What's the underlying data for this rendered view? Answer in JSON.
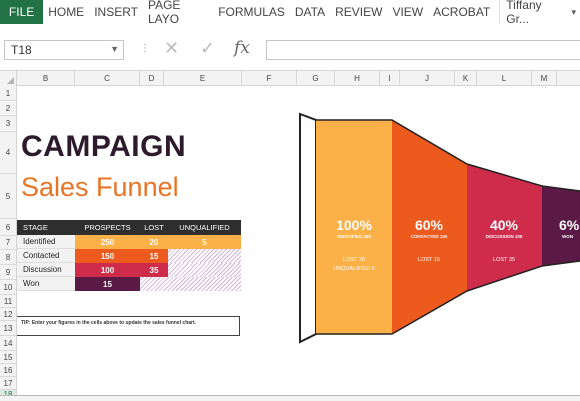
{
  "ribbon": {
    "file_tab": "FILE",
    "tabs": [
      "HOME",
      "INSERT",
      "PAGE LAYO",
      "FORMULAS",
      "DATA",
      "REVIEW",
      "VIEW",
      "ACROBAT"
    ],
    "user": "Tiffany Gr...",
    "user_dropdown": "▾"
  },
  "formula_bar": {
    "name_box": "T18",
    "fx": "fx",
    "value": ""
  },
  "columns": [
    "B",
    "C",
    "D",
    "E",
    "F",
    "G",
    "H",
    "I",
    "J",
    "K",
    "L",
    "M"
  ],
  "rows": [
    "1",
    "2",
    "3",
    "4",
    "5",
    "6",
    "7",
    "8",
    "9",
    "10",
    "11",
    "12",
    "13",
    "14",
    "15",
    "16",
    "17",
    "18"
  ],
  "sheet": {
    "title_line1": "CAMPAIGN",
    "title_line2": "Sales Funnel",
    "table": {
      "headers": [
        "STAGE",
        "PROSPECTS",
        "LOST",
        "UNQUALIFIED"
      ],
      "rows": [
        {
          "stage": "Identified",
          "prospects": "250",
          "lost": "20",
          "unqualified": "5"
        },
        {
          "stage": "Contacted",
          "prospects": "150",
          "lost": "15",
          "unqualified": ""
        },
        {
          "stage": "Discussion",
          "prospects": "100",
          "lost": "35",
          "unqualified": ""
        },
        {
          "stage": "Won",
          "prospects": "15",
          "lost": "",
          "unqualified": ""
        }
      ]
    },
    "tip": "TIP: Enter your figures in the cells above to update the sales funnel chart."
  },
  "funnel": {
    "stages": [
      {
        "percent": "100%",
        "label": "IDENTIFIED 250",
        "lost": "LOST 20",
        "extra": "UNQUALIFIED 5",
        "color": "#fbb048"
      },
      {
        "percent": "60%",
        "label": "CONTACTED 150",
        "lost": "LOST 15",
        "extra": "",
        "color": "#ec5a1d"
      },
      {
        "percent": "40%",
        "label": "DISCUSSION 100",
        "lost": "LOST 35",
        "extra": "",
        "color": "#cf2c4b"
      },
      {
        "percent": "6%",
        "label": "WON",
        "lost": "",
        "extra": "",
        "color": "#5b1a45"
      }
    ]
  },
  "colors": {
    "excel_green": "#217346",
    "title_dark": "#2d1a2c",
    "title_orange": "#e87425"
  }
}
